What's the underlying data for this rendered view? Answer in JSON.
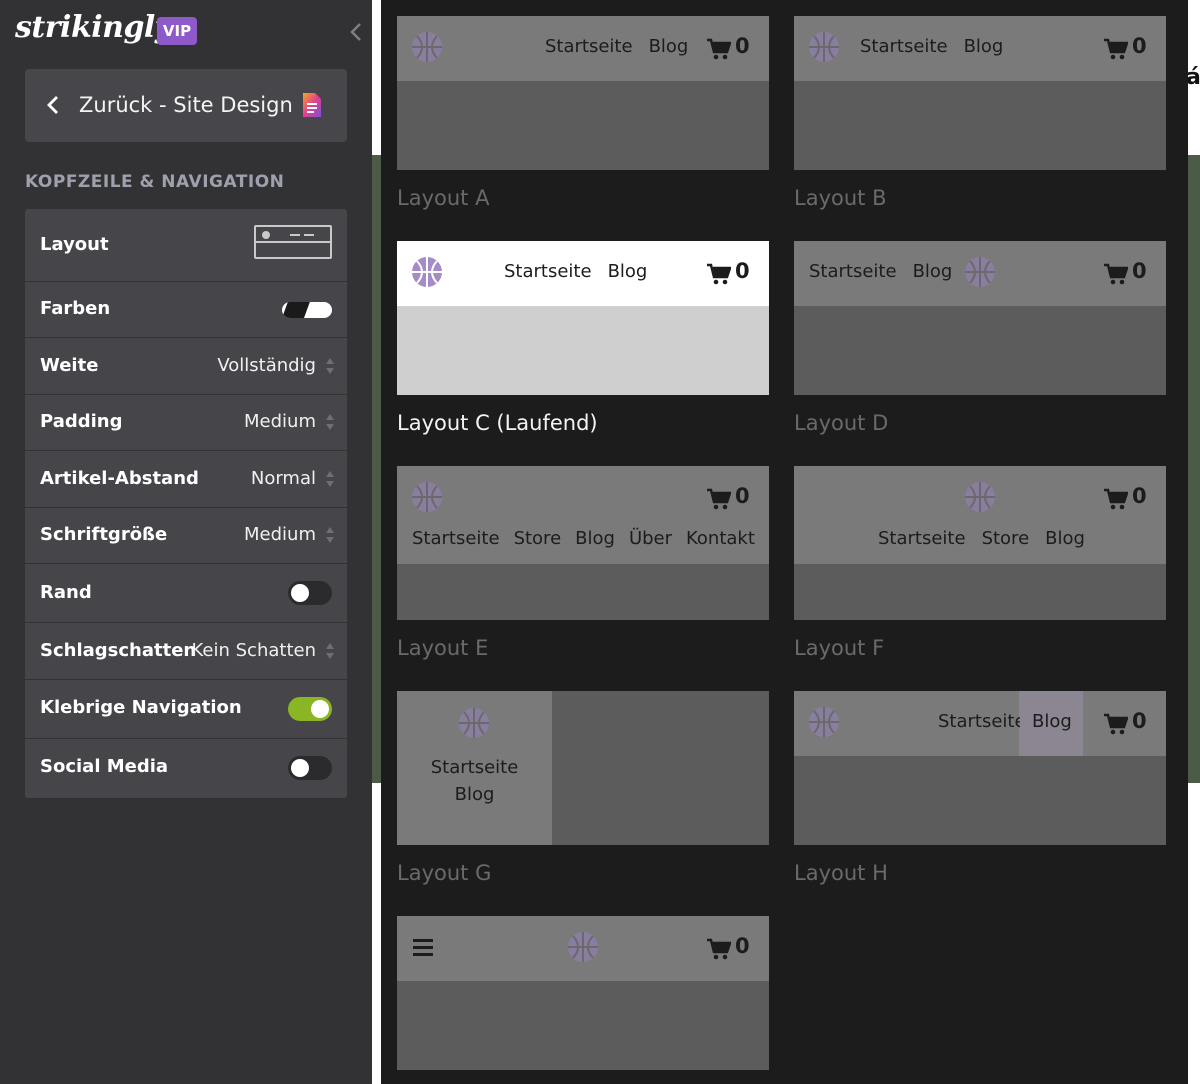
{
  "brand": {
    "logo_text": "strikingly",
    "badge": "VIP"
  },
  "sidebar": {
    "back_label": "Zurück - Site Design",
    "section_title": "KOPFZEILE & NAVIGATION",
    "settings": {
      "layout": {
        "label": "Layout"
      },
      "colors": {
        "label": "Farben"
      },
      "width": {
        "label": "Weite",
        "value": "Vollständig"
      },
      "padding": {
        "label": "Padding",
        "value": "Medium"
      },
      "item_spacing": {
        "label": "Artikel-Abstand",
        "value": "Normal"
      },
      "font_size": {
        "label": "Schriftgröße",
        "value": "Medium"
      },
      "border": {
        "label": "Rand",
        "enabled": false
      },
      "shadow": {
        "label": "Schlagschatten",
        "value": "Kein Schatten"
      },
      "sticky_nav": {
        "label": "Klebrige Navigation",
        "enabled": true
      },
      "social_media": {
        "label": "Social Media",
        "enabled": false
      }
    }
  },
  "site_preview": {
    "edge_text": "á"
  },
  "layouts": {
    "cart_count": "0",
    "nav": {
      "home": "Startseite",
      "store": "Store",
      "blog": "Blog",
      "about": "Über",
      "contact": "Kontakt"
    },
    "items": [
      {
        "id": "A",
        "caption": "Layout A"
      },
      {
        "id": "B",
        "caption": "Layout B"
      },
      {
        "id": "C",
        "caption": "Layout C (Laufend)",
        "current": true
      },
      {
        "id": "D",
        "caption": "Layout D"
      },
      {
        "id": "E",
        "caption": "Layout E"
      },
      {
        "id": "F",
        "caption": "Layout F"
      },
      {
        "id": "G",
        "caption": "Layout G"
      },
      {
        "id": "H",
        "caption": "Layout H"
      },
      {
        "id": "I",
        "caption": ""
      }
    ]
  },
  "colors": {
    "sidebar_bg": "#323235",
    "panel_bg": "#46464a",
    "accent_vip": "#8e59c9",
    "toggle_on": "#8ab525",
    "logo_purple": "#a58cc6"
  },
  "icons": [
    "chevron-left-icon",
    "document-icon",
    "spinner-arrows-icon",
    "cart-icon",
    "basketball-logo-icon",
    "hamburger-icon"
  ]
}
